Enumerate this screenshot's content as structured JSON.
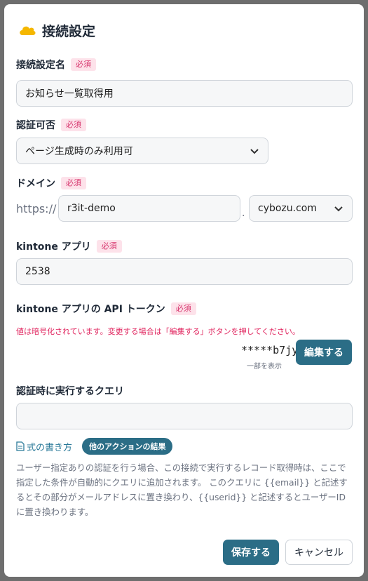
{
  "dialog": {
    "title": "接続設定",
    "accent_color": "#f5b700"
  },
  "fields": {
    "connection_name": {
      "label": "接続設定名",
      "required": "必須",
      "value": "お知らせ一覧取得用"
    },
    "auth": {
      "label": "認証可否",
      "required": "必須",
      "selected": "ページ生成時のみ利用可"
    },
    "domain": {
      "label": "ドメイン",
      "required": "必須",
      "prefix": "https://",
      "subdomain": "r3it-demo",
      "separator": ".",
      "selected": "cybozu.com"
    },
    "app": {
      "label": "kintone アプリ",
      "required": "必須",
      "value": "2538"
    },
    "token": {
      "label": "kintone アプリの API トークン",
      "required": "必須",
      "note": "値は暗号化されています。変更する場合は「編集する」ボタンを押してください。",
      "masked_value": "*****b7jy",
      "hint": "一部を表示",
      "edit_label": "編集する"
    },
    "query": {
      "label": "認証時に実行するクエリ",
      "value": "",
      "formula_link": "式の書き方",
      "other_results": "他のアクションの結果",
      "description": "ユーザー指定ありの認証を行う場合、この接続で実行するレコード取得時は、ここで指定した条件が自動的にクエリに追加されます。 このクエリに {{email}} と記述するとその部分がメールアドレスに置き換わり、{{userid}} と記述するとユーザーIDに置き換わります。"
    }
  },
  "footer": {
    "save_label": "保存する",
    "cancel_label": "キャンセル"
  },
  "colors": {
    "primary": "#2b6d86",
    "required_bg": "#fde2ea",
    "required_text": "#d6336c",
    "note_red": "#e0245e"
  }
}
